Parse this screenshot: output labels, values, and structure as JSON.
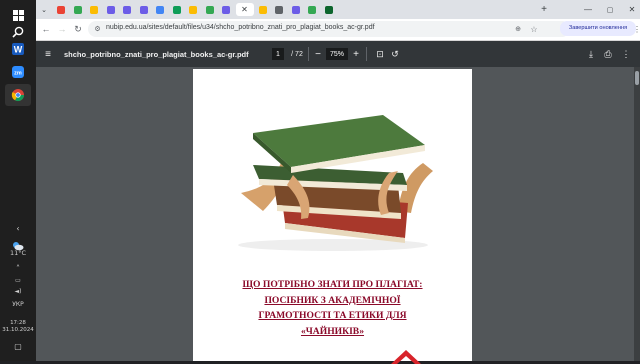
{
  "taskbar": {
    "start_icon": "windows-start-icon",
    "apps": [
      "search-icon",
      "word-icon",
      "zoom-icon",
      "chrome-icon"
    ],
    "weather_temp": "11°C",
    "language": "УКР",
    "time": "17:28",
    "date": "31.10.2024"
  },
  "browser": {
    "tab_favicons": [
      {
        "color": "#ea4335"
      },
      {
        "color": "#34a853"
      },
      {
        "color": "#fbbc04"
      },
      {
        "color": "#6c5ce7"
      },
      {
        "color": "#6c5ce7"
      },
      {
        "color": "#6c5ce7"
      },
      {
        "color": "#4285f4"
      },
      {
        "color": "#0f9d58"
      },
      {
        "color": "#fbbc04"
      },
      {
        "color": "#34a853"
      },
      {
        "color": "#6c5ce7"
      },
      {
        "color": "#fbbc04"
      },
      {
        "color": "#5f6368"
      },
      {
        "color": "#6c5ce7"
      },
      {
        "color": "#34a853"
      },
      {
        "color": "#0d652d"
      }
    ],
    "url": "nubip.edu.ua/sites/default/files/u34/shcho_potribno_znati_pro_plagiat_books_ac-gr.pdf",
    "update_button_label": "Завершити оновлення",
    "new_tab_label": "+"
  },
  "pdf": {
    "file_name": "shcho_potribno_znati_pro_plagiat_books_ac-gr.pdf",
    "current_page": "1",
    "total_pages": "/ 72",
    "zoom": "75%"
  },
  "document": {
    "title_lines": [
      "ЩО ПОТРІБНО ЗНАТИ ПРО ПЛАГІАТ:",
      "ПОСІБНИК З АКАДЕМІЧНОЇ",
      "ГРАМОТНОСТІ ТА ЕТИКИ  ДЛЯ",
      "«ЧАЙНИКІВ»"
    ]
  },
  "colors": {
    "heading": "#8b0a2a",
    "pdf_toolbar": "#323639",
    "viewer_bg": "#525659",
    "taskbar": "#1f1f1f"
  }
}
